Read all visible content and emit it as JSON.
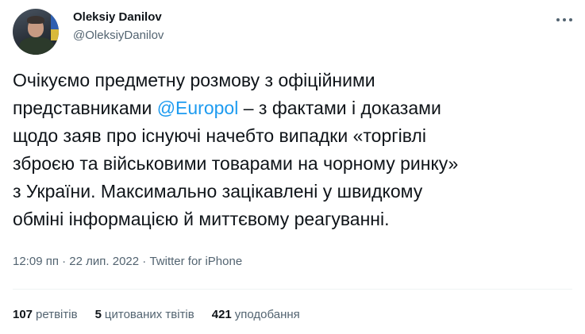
{
  "author": {
    "display_name": "Oleksiy Danilov",
    "handle": "@OleksiyDanilov"
  },
  "tweet": {
    "line1": "Очікуємо предметну розмову з офіційними",
    "line2_pre": "представниками ",
    "mention": "@Europol",
    "line2_post": " – з фактами і доказами",
    "line3": "щодо заяв про існуючі начебто випадки «торгівлі",
    "line4": "зброєю та військовими товарами на чорному ринку»",
    "line5": "з України. Максимально зацікавлені у швидкому",
    "line6": "обміні інформацією й миттєвому реагуванні."
  },
  "meta": {
    "time": "12:09 пп",
    "date": "22 лип. 2022",
    "source": "Twitter for iPhone"
  },
  "stats": {
    "retweets_count": "107",
    "retweets_label": "ретвітів",
    "quotes_count": "5",
    "quotes_label": "цитованих твітів",
    "likes_count": "421",
    "likes_label": "уподобання"
  },
  "colors": {
    "link": "#1d9bf0",
    "text": "#0f1419",
    "secondary": "#536471"
  },
  "icons": {
    "more": "more-dots-icon"
  }
}
